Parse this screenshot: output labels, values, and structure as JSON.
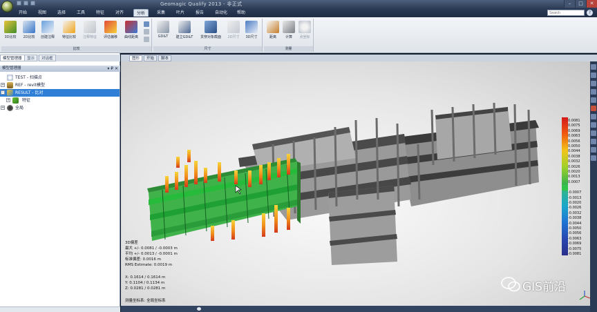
{
  "window": {
    "title": "Geomagic Qualify 2013 - 非正式"
  },
  "menu": {
    "tabs": [
      "开始",
      "视图",
      "选择",
      "工具",
      "特征",
      "对齐",
      "分析",
      "采集",
      "叶片",
      "报告",
      "自动化",
      "帮助"
    ],
    "active": "分析",
    "search_placeholder": "Search",
    "help_label": "?"
  },
  "ribbon": {
    "groups": [
      {
        "label": "比较",
        "buttons": [
          "3D比较",
          "2D比较",
          "创建注释",
          "特征比较",
          "注释特征",
          "评估偏移",
          "曲线距离"
        ]
      },
      {
        "label": "尺寸",
        "buttons": [
          "GD&T",
          "建立GD&T",
          "贯穿对象截面",
          "2D尺寸",
          "3D尺寸"
        ]
      },
      {
        "label": "测量",
        "buttons": [
          "距离",
          "计算",
          "点坐标"
        ]
      }
    ]
  },
  "left_panel": {
    "tabs": [
      "模型管理器",
      "显示",
      "对话框"
    ],
    "title": "模型管理器",
    "controls": "▾ ₽ ✕",
    "tree": [
      {
        "label": "TEST - 扫描点",
        "indent": 0,
        "selected": false
      },
      {
        "label": "REF - revit模型",
        "indent": 0,
        "selected": false
      },
      {
        "label": "RESULT - 比对",
        "indent": 0,
        "selected": true
      },
      {
        "label": "特征",
        "indent": 1,
        "selected": false
      },
      {
        "label": "全局",
        "indent": 0,
        "selected": false
      }
    ]
  },
  "viewport": {
    "tabs": [
      "图形",
      "开始",
      "脚本"
    ],
    "active_tab": "图形"
  },
  "legend": {
    "labels": [
      "0.0081",
      "0.0075",
      "0.0069",
      "0.0063",
      "0.0056",
      "0.0050",
      "0.0044",
      "0.0038",
      "0.0032",
      "0.0026",
      "0.0020",
      "0.0013",
      "0.0007",
      "-0.0007",
      "-0.0013",
      "-0.0020",
      "-0.0026",
      "-0.0032",
      "-0.0038",
      "-0.0044",
      "-0.0050",
      "-0.0056",
      "-0.0063",
      "-0.0069",
      "-0.0075",
      "-0.0081"
    ]
  },
  "stats": {
    "lines": [
      "3D偏差",
      "最大 +/- 0.0081 / -0.0003 m",
      "平均 +/- 0.0013 / -0.0001 m",
      "标准偏差: 0.0016 m",
      "RMS Estimate: 0.0019 m",
      "",
      "X: 0.1614 / 0.1614 m",
      "Y: 0.1104 / 0.1134 m",
      "Z: 0.0281 / 0.0281 m",
      "",
      "测量坐标系: 全局坐标系"
    ]
  },
  "watermark": {
    "text": "GIS前沿"
  },
  "colors": {
    "accent": "#2f7fd6",
    "ribbon_bg": "#e9edf2",
    "titlebar": "#2f3e57"
  }
}
